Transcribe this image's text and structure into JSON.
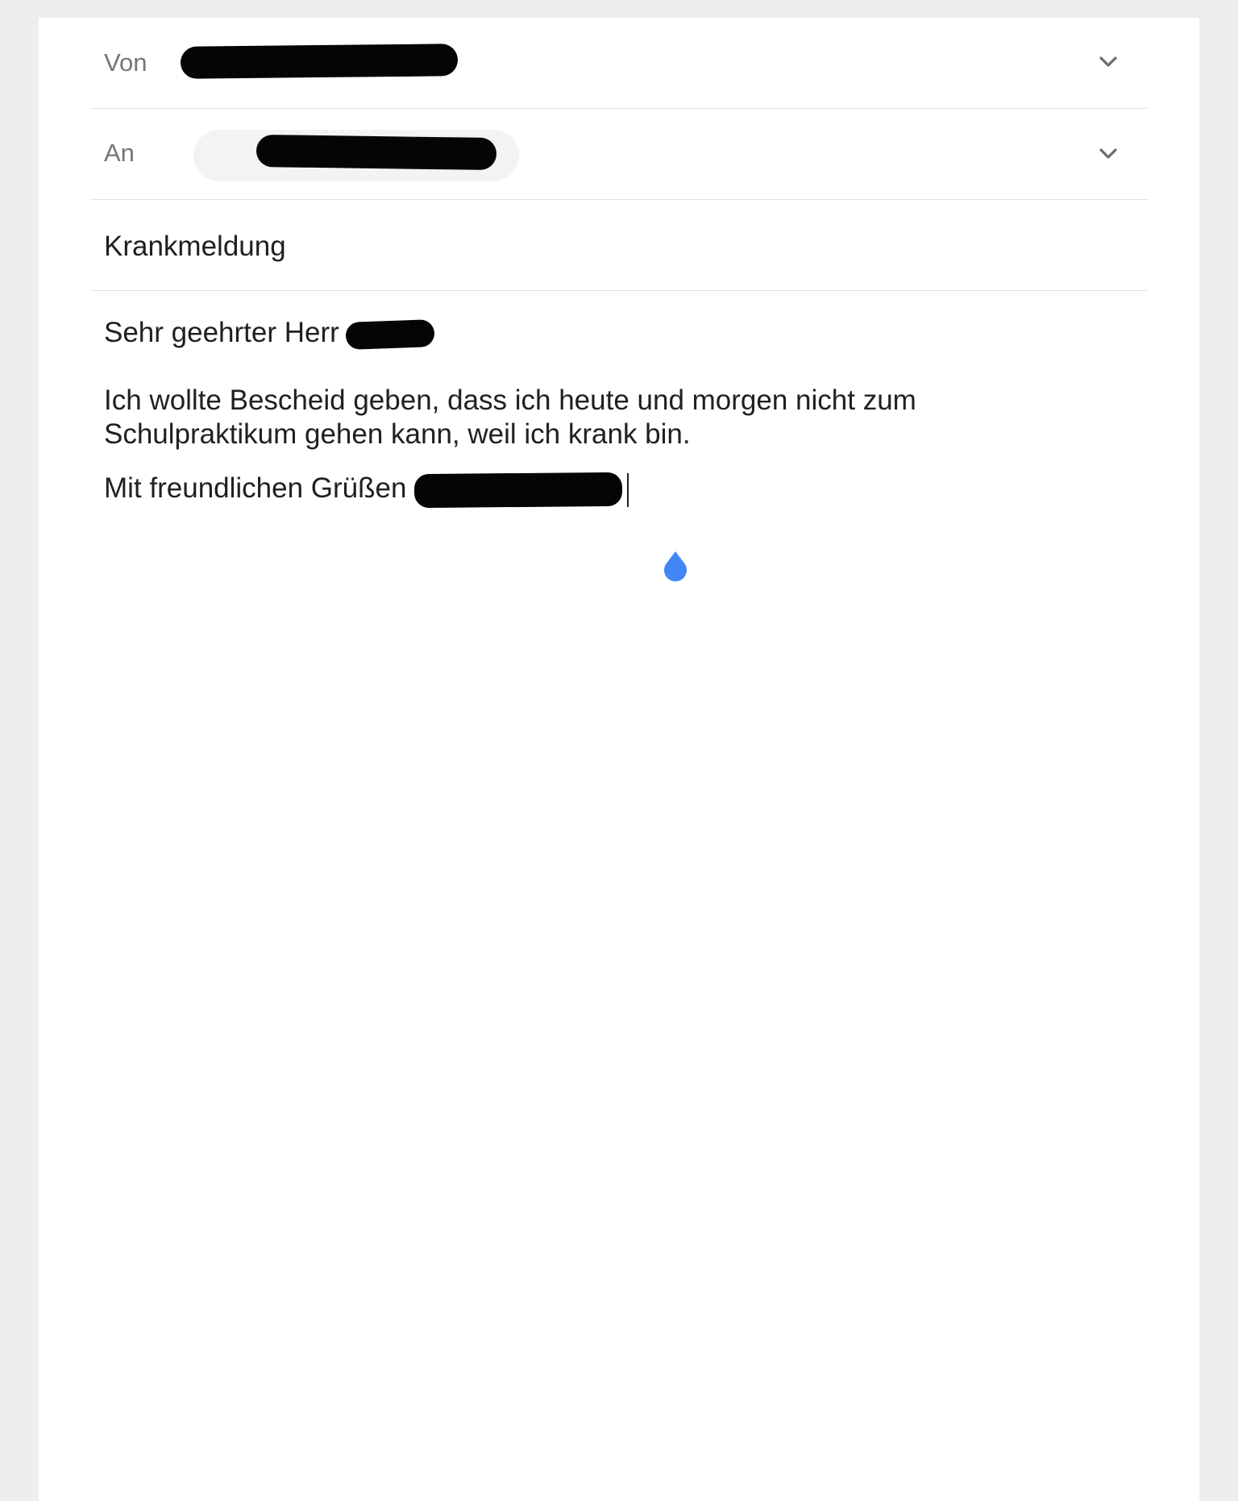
{
  "compose": {
    "from": {
      "label": "Von",
      "icon": "chevron-down-icon"
    },
    "to": {
      "label": "An",
      "icon": "chevron-down-icon"
    },
    "subject": "Krankmeldung",
    "body": {
      "greeting": "Sehr geehrter Herr",
      "main": "Ich wollte Bescheid geben, dass ich heute und morgen nicht zum Schulpraktikum gehen kann, weil ich krank bin.",
      "closing": "Mit freundlichen Grüßen"
    }
  },
  "colors": {
    "background": "#eeeeee",
    "sheet": "#ffffff",
    "text": "#202020",
    "label": "#757575",
    "divider": "#e2e2e2",
    "chip": "#f3f3f3",
    "cursor_handle": "#4285f4"
  }
}
